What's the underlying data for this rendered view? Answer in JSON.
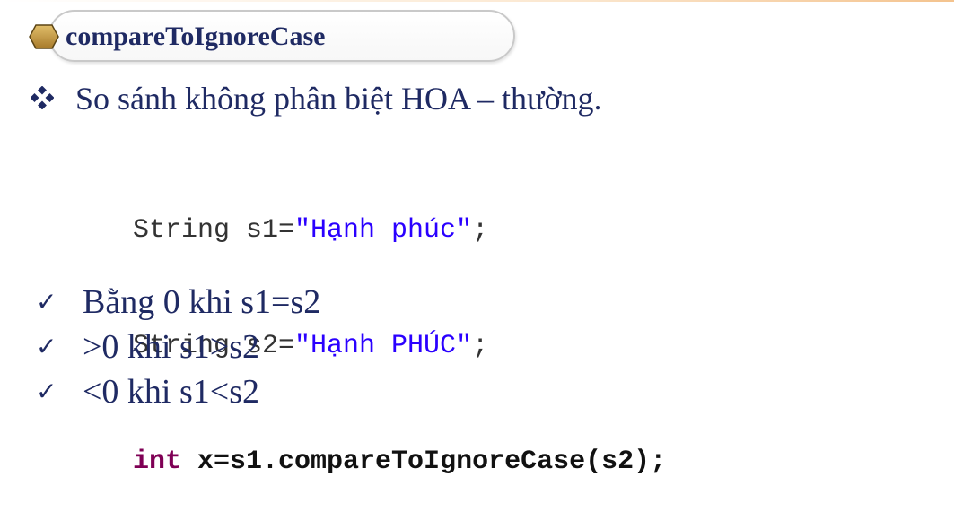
{
  "slide": {
    "title": "compareToIgnoreCase",
    "subtitle": "So sánh không phân biệt HOA – thường."
  },
  "code": {
    "line1_prefix": "String s1=",
    "line1_string": "\"Hạnh phúc\"",
    "line1_suffix": ";",
    "line2_prefix": "String s2=",
    "line2_string": "\"Hạnh PHÚC\"",
    "line2_suffix": ";",
    "line3_keyword": "int",
    "line3_rest": " x=s1.compareToIgnoreCase(s2);"
  },
  "results": [
    {
      "icon": "check-icon",
      "text": "Bằng 0 khi s1=s2"
    },
    {
      "icon": "check-icon",
      "text": ">0 khi s1>s2"
    },
    {
      "icon": "check-icon",
      "text": "<0 khi s1<s2"
    }
  ],
  "colors": {
    "title_text": "#1f2a63",
    "hex_icon": "#c9a04e",
    "code_string": "#2a00ff",
    "code_keyword": "#7f0055"
  }
}
